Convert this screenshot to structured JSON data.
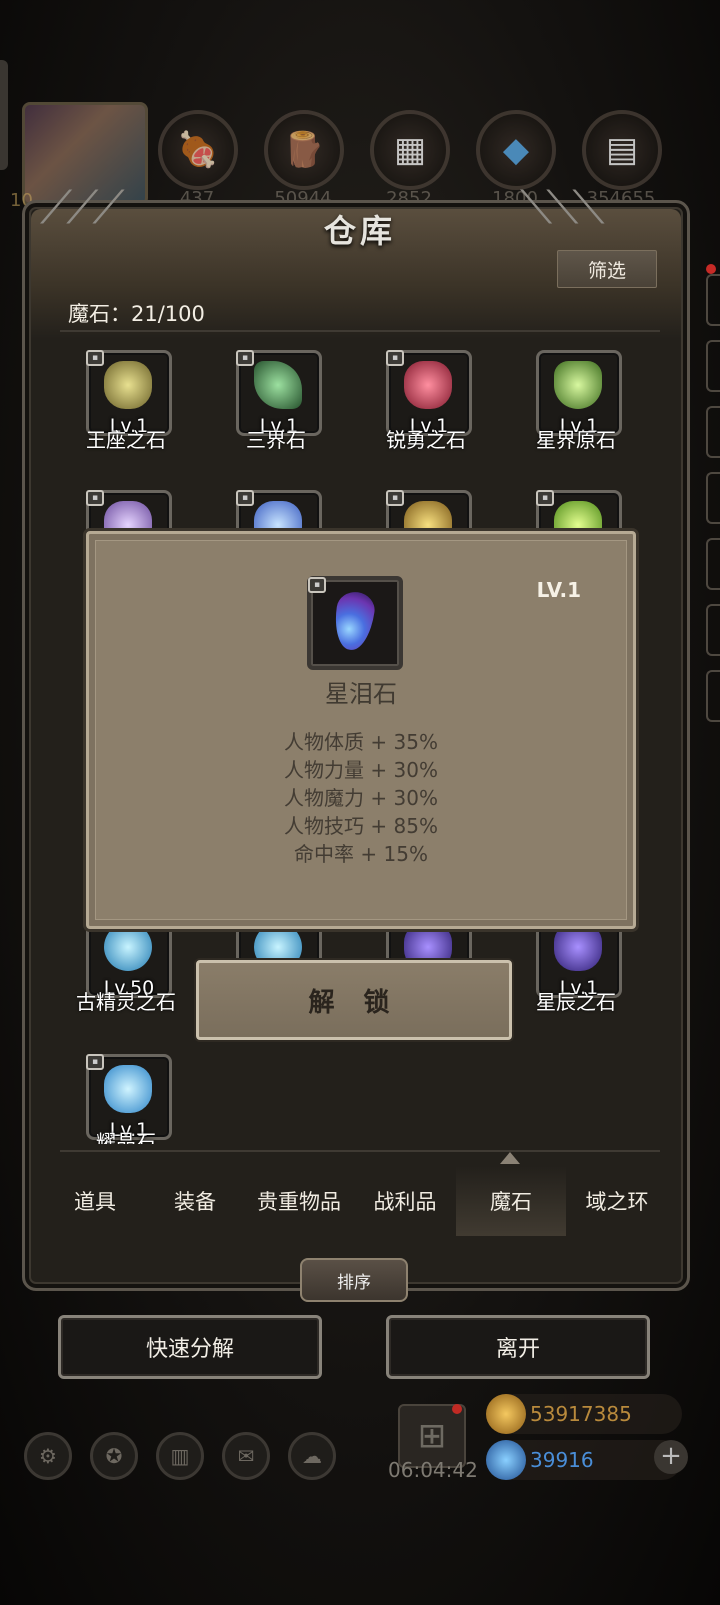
{
  "header": {
    "avatar_level": "10",
    "resources": [
      {
        "icon": "meat-icon",
        "value": "437"
      },
      {
        "icon": "wood-icon",
        "value": "50944"
      },
      {
        "icon": "stone-icon",
        "value": "2852"
      },
      {
        "icon": "crystal-icon",
        "value": "1800"
      },
      {
        "icon": "iron-icon",
        "value": "354655"
      }
    ]
  },
  "panel": {
    "title": "仓库",
    "filter_label": "筛选",
    "stone_count": "魔石：21/100"
  },
  "stones": [
    {
      "name": "王座之石",
      "level": "Lv.1",
      "color": "#c9c05a"
    },
    {
      "name": "三界石",
      "level": "Lv.1",
      "color": "#4c8a52"
    },
    {
      "name": "锐勇之石",
      "level": "Lv.1",
      "color": "#d64256"
    },
    {
      "name": "星界原石",
      "level": "Lv.1",
      "color": "#8ed06a"
    },
    {
      "name": "",
      "level": "",
      "color": "#b9a0d8"
    },
    {
      "name": "",
      "level": "",
      "color": "#6ea0e8"
    },
    {
      "name": "",
      "level": "",
      "color": "#d8b04a"
    },
    {
      "name": "",
      "level": "",
      "color": "#a6e04a"
    },
    {
      "name": "古精灵之石",
      "level": "Lv.50",
      "color": "#4ec2ee"
    },
    {
      "name": "",
      "level": "",
      "color": "#4ec2ee"
    },
    {
      "name": "",
      "level": "",
      "color": "#6a4ac8"
    },
    {
      "name": "星辰之石",
      "level": "Lv.1",
      "color": "#5c4ac0"
    },
    {
      "name": "耀晶石",
      "level": "Lv.1",
      "color": "#62c6ee"
    }
  ],
  "popup": {
    "level": "LV.1",
    "name": "星泪石",
    "attributes": [
      "人物体质 + 35%",
      "人物力量 + 30%",
      "人物魔力 + 30%",
      "人物技巧 + 85%",
      "命中率 + 15%"
    ]
  },
  "unlock_label": "解 锁",
  "tabs": [
    "道具",
    "装备",
    "贵重物品",
    "战利品",
    "魔石",
    "域之环"
  ],
  "active_tab": 4,
  "sort_label": "排序",
  "actions": {
    "decompose": "快速分解",
    "leave": "离开"
  },
  "footer": {
    "timer": "06:04:42",
    "gold": "53917385",
    "gems": "39916",
    "gold_color": "#e0a43a",
    "gem_color": "#3a8fe0"
  }
}
